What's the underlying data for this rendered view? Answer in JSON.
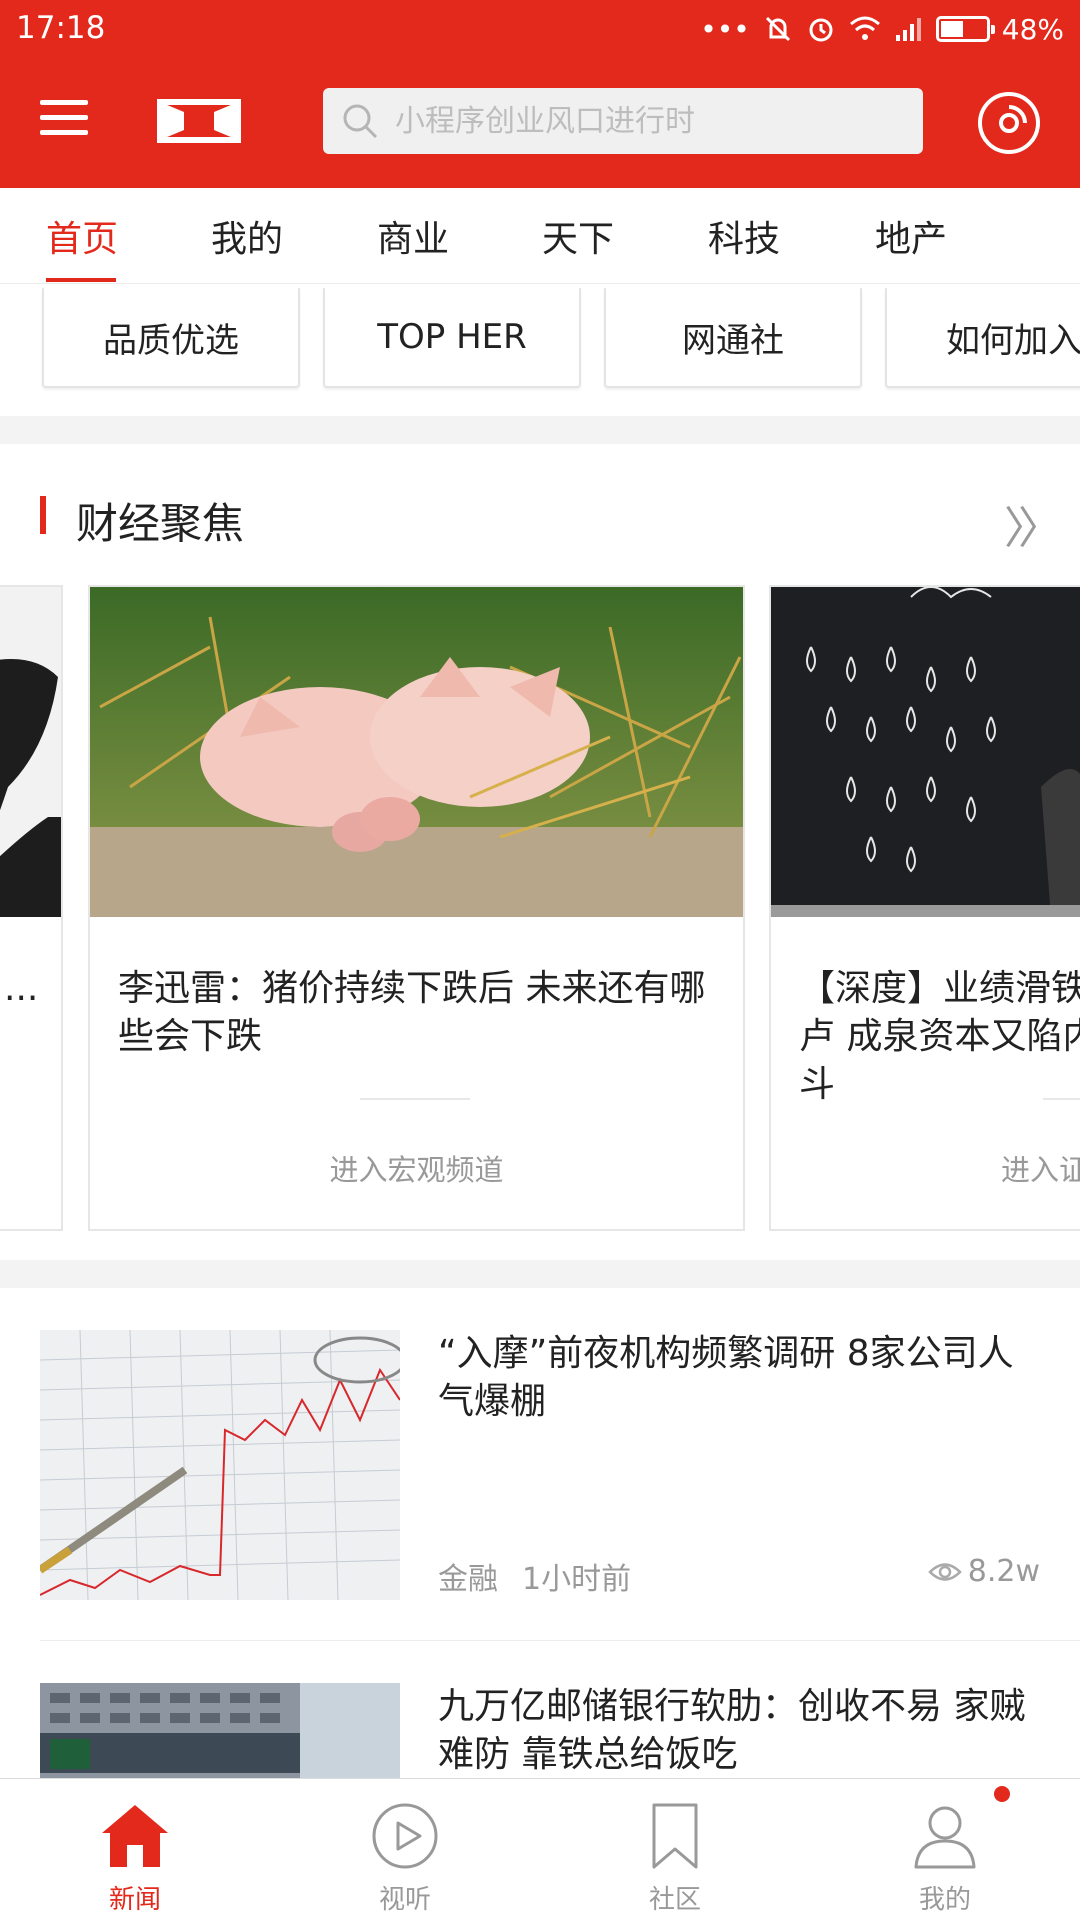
{
  "status_bar": {
    "time": "17:18",
    "battery": "48%"
  },
  "header": {
    "search_placeholder": "小程序创业风口进行时"
  },
  "tabs": [
    {
      "label": "首页",
      "active": true
    },
    {
      "label": "我的"
    },
    {
      "label": "商业"
    },
    {
      "label": "天下"
    },
    {
      "label": "科技"
    },
    {
      "label": "地产"
    }
  ],
  "pills": [
    "品质优选",
    "TOP HER",
    "网通社",
    "如何加入"
  ],
  "section": {
    "title": "财经聚焦",
    "more_icon": "double-chevron-right"
  },
  "cards": [
    {
      "title": "...",
      "channel": ""
    },
    {
      "title": "李迅雷：猪价持续下跌后 未来还有哪些会下跌",
      "channel": "进入宏观频道"
    },
    {
      "title": "【深度】业绩滑铁卢 成泉资本又陷内斗",
      "channel": "进入证券频道"
    }
  ],
  "news": [
    {
      "title": "“入摩”前夜机构频繁调研 8家公司人气爆棚",
      "category": "金融",
      "time": "1小时前",
      "views": "8.2w"
    },
    {
      "title": "九万亿邮储银行软肋：创收不易 家贼难防 靠铁总给饭吃",
      "category": "",
      "time": "",
      "views": ""
    }
  ],
  "bottom_nav": [
    {
      "label": "新闻",
      "icon": "home-icon",
      "active": true
    },
    {
      "label": "视听",
      "icon": "play-icon"
    },
    {
      "label": "社区",
      "icon": "bookmark-icon"
    },
    {
      "label": "我的",
      "icon": "user-icon",
      "badge": true
    }
  ],
  "colors": {
    "brand_red": "#e3291c",
    "text": "#222222",
    "muted": "#999999",
    "divider": "#f3f3f3"
  }
}
